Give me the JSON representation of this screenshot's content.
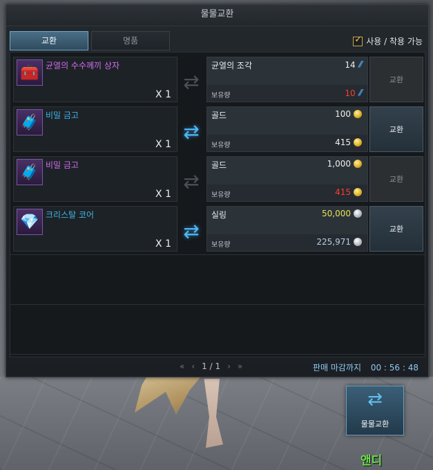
{
  "window": {
    "title": "물물교환"
  },
  "tabs": [
    {
      "label": "교환"
    },
    {
      "label": "명품"
    }
  ],
  "filter": {
    "label": "사용 / 착용 가능",
    "checked": true
  },
  "common": {
    "owned_label": "보유량",
    "exchange_label": "교환"
  },
  "rows": [
    {
      "item_name": "균열의 수수께끼 상자",
      "name_color": "purple",
      "icon": "chest-icon",
      "quantity": "X 1",
      "enabled": false,
      "cost_name": "균열의 조각",
      "cost_value": "14",
      "currency": "rift-shard",
      "owned_value": "10",
      "owned_color": "red"
    },
    {
      "item_name": "비밀 금고",
      "name_color": "blue",
      "icon": "chest-icon",
      "quantity": "X 1",
      "enabled": true,
      "cost_name": "골드",
      "cost_value": "100",
      "currency": "gold-coin",
      "owned_value": "415",
      "owned_color": "white"
    },
    {
      "item_name": "비밀 금고",
      "name_color": "purple",
      "icon": "chest-icon",
      "quantity": "X 1",
      "enabled": false,
      "cost_name": "골드",
      "cost_value": "1,000",
      "currency": "gold-coin",
      "owned_value": "415",
      "owned_color": "red"
    },
    {
      "item_name": "크리스탈 코어",
      "name_color": "blue",
      "icon": "crystal-icon",
      "quantity": "X 1",
      "enabled": true,
      "cost_name": "실링",
      "cost_value": "50,000",
      "cost_color": "yellow",
      "currency": "silver-coin",
      "owned_value": "225,971",
      "owned_color": "lblue"
    }
  ],
  "pager": {
    "first": "«",
    "prev": "‹",
    "page": "1 / 1",
    "next": "›",
    "last": "»"
  },
  "deadline": {
    "label": "판매 마감까지",
    "time": "00 : 56 : 48"
  },
  "big_button": {
    "label": "물물교환"
  },
  "npc": {
    "name": "앤디"
  },
  "colors": {
    "accent": "#4fb6f0",
    "purple": "#d36bf0",
    "blue": "#3fb4ea",
    "red": "#ff3b2f",
    "npc": "#6fe04a"
  }
}
